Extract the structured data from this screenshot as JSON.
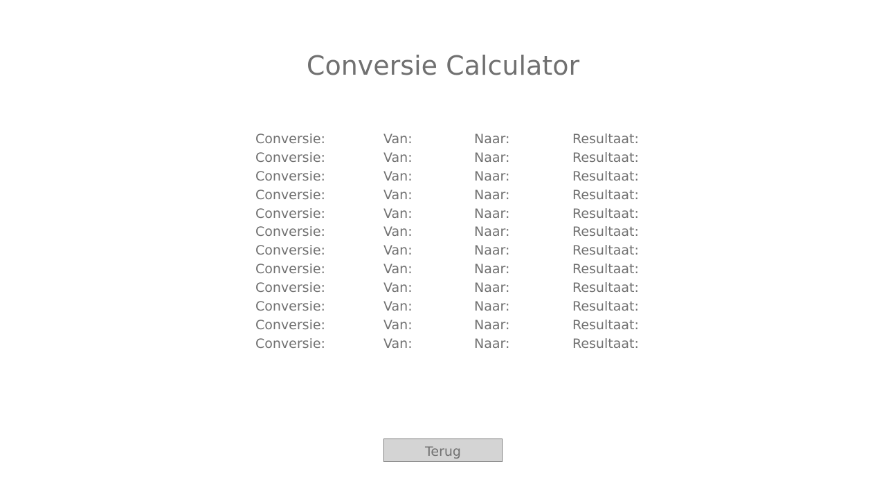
{
  "page": {
    "title": "Conversie Calculator"
  },
  "history": {
    "rows": [
      {
        "conversie": "Conversie:",
        "van": "Van:",
        "naar": "Naar:",
        "resultaat": "Resultaat:"
      },
      {
        "conversie": "Conversie:",
        "van": "Van:",
        "naar": "Naar:",
        "resultaat": "Resultaat:"
      },
      {
        "conversie": "Conversie:",
        "van": "Van:",
        "naar": "Naar:",
        "resultaat": "Resultaat:"
      },
      {
        "conversie": "Conversie:",
        "van": "Van:",
        "naar": "Naar:",
        "resultaat": "Resultaat:"
      },
      {
        "conversie": "Conversie:",
        "van": "Van:",
        "naar": "Naar:",
        "resultaat": "Resultaat:"
      },
      {
        "conversie": "Conversie:",
        "van": "Van:",
        "naar": "Naar:",
        "resultaat": "Resultaat:"
      },
      {
        "conversie": "Conversie:",
        "van": "Van:",
        "naar": "Naar:",
        "resultaat": "Resultaat:"
      },
      {
        "conversie": "Conversie:",
        "van": "Van:",
        "naar": "Naar:",
        "resultaat": "Resultaat:"
      },
      {
        "conversie": "Conversie:",
        "van": "Van:",
        "naar": "Naar:",
        "resultaat": "Resultaat:"
      },
      {
        "conversie": "Conversie:",
        "van": "Van:",
        "naar": "Naar:",
        "resultaat": "Resultaat:"
      },
      {
        "conversie": "Conversie:",
        "van": "Van:",
        "naar": "Naar:",
        "resultaat": "Resultaat:"
      },
      {
        "conversie": "Conversie:",
        "van": "Van:",
        "naar": "Naar:",
        "resultaat": "Resultaat:"
      }
    ]
  },
  "actions": {
    "back_label": "Terug"
  },
  "colors": {
    "text": "#707070",
    "button_background": "#d4d4d4",
    "button_border": "#7a7a7a",
    "background": "#ffffff"
  }
}
